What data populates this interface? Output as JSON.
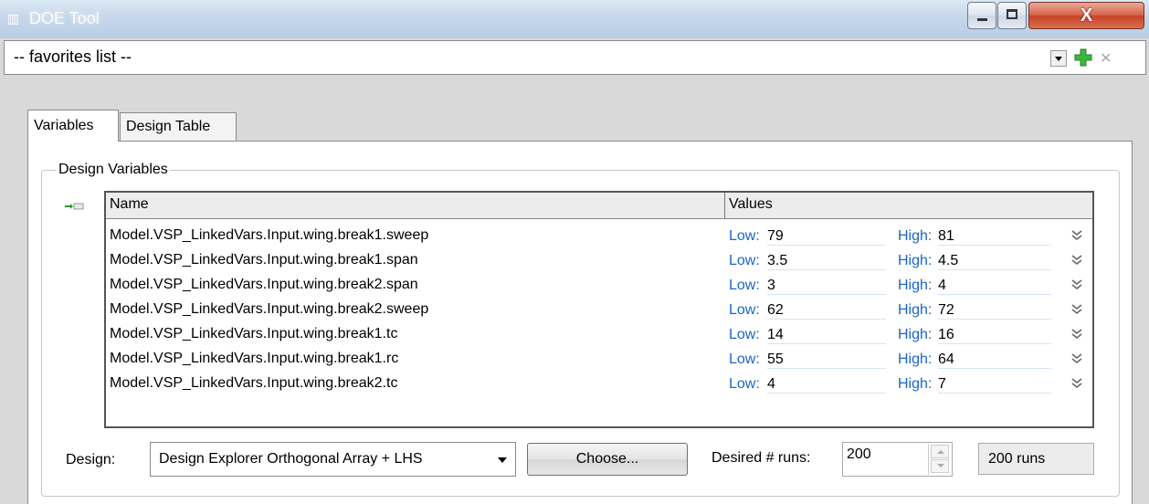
{
  "window": {
    "title": "DOE Tool"
  },
  "favorites": {
    "value": "-- favorites list --"
  },
  "tabs": [
    {
      "label": "Variables"
    },
    {
      "label": "Design Table"
    }
  ],
  "design_variables": {
    "group_label": "Design Variables",
    "columns": {
      "name": "Name",
      "values": "Values"
    },
    "low_label": "Low:",
    "high_label": "High:",
    "rows": [
      {
        "name": "Model.VSP_LinkedVars.Input.wing.break1.sweep",
        "low": "79",
        "high": "81"
      },
      {
        "name": "Model.VSP_LinkedVars.Input.wing.break1.span",
        "low": "3.5",
        "high": "4.5"
      },
      {
        "name": "Model.VSP_LinkedVars.Input.wing.break2.span",
        "low": "3",
        "high": "4"
      },
      {
        "name": "Model.VSP_LinkedVars.Input.wing.break2.sweep",
        "low": "62",
        "high": "72"
      },
      {
        "name": "Model.VSP_LinkedVars.Input.wing.break1.tc",
        "low": "14",
        "high": "16"
      },
      {
        "name": "Model.VSP_LinkedVars.Input.wing.break1.rc",
        "low": "55",
        "high": "64"
      },
      {
        "name": "Model.VSP_LinkedVars.Input.wing.break2.tc",
        "low": "4",
        "high": "7"
      }
    ]
  },
  "design": {
    "label": "Design:",
    "selected": "Design Explorer Orthogonal Array + LHS",
    "choose_label": "Choose...",
    "runs_label": "Desired # runs:",
    "runs_value": "200",
    "runs_result": "200 runs"
  },
  "colors": {
    "link_blue": "#1a66c8",
    "close_red": "#c74228",
    "add_green": "#3cb83c"
  }
}
